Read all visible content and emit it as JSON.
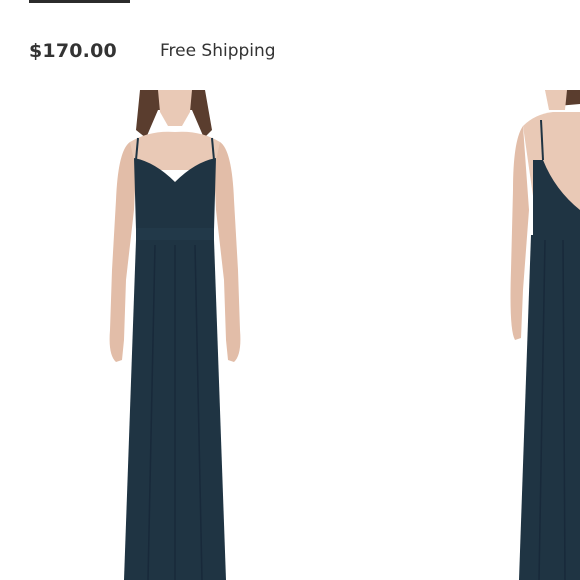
{
  "listing": {
    "price": "$170.00",
    "shipping": "Free Shipping"
  },
  "colors": {
    "text": "#333333",
    "dress": "#1f3443",
    "skin": "#e9c9b6",
    "hair": "#5a3d2e",
    "background": "#ffffff"
  },
  "images": [
    {
      "view": "front",
      "icon": "dress-front-image"
    },
    {
      "view": "back",
      "icon": "dress-back-image"
    }
  ]
}
